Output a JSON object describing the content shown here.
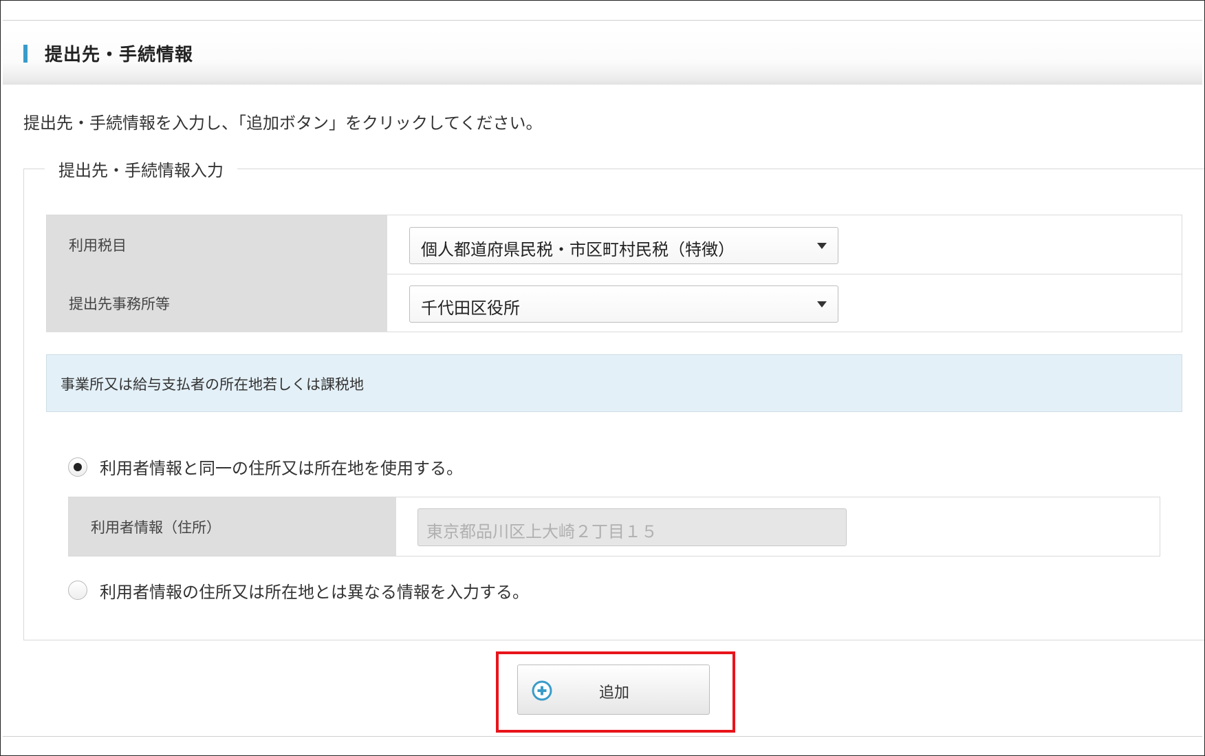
{
  "section": {
    "title": "提出先・手続情報",
    "instruction": "提出先・手続情報を入力し、「追加ボタン」をクリックしてください。"
  },
  "form": {
    "legend": "提出先・手続情報入力",
    "tax_item": {
      "label": "利用税目",
      "value": "個人都道府県民税・市区町村民税（特徴）"
    },
    "office": {
      "label": "提出先事務所等",
      "value": "千代田区役所"
    }
  },
  "location": {
    "heading": "事業所又は給与支払者の所在地若しくは課税地",
    "option_same": {
      "label": "利用者情報と同一の住所又は所在地を使用する。",
      "selected": true
    },
    "user_address": {
      "label": "利用者情報（住所）",
      "value": "東京都品川区上大崎２丁目１５"
    },
    "option_different": {
      "label": "利用者情報の住所又は所在地とは異なる情報を入力する。",
      "selected": false
    }
  },
  "actions": {
    "add_label": "追加"
  },
  "colors": {
    "accent_bar": "#3a9bc9",
    "highlight_border": "#e8141b",
    "info_band": "#e3f0f7",
    "label_cell": "#dedede"
  },
  "icons": {
    "add": "plus-circle-icon",
    "select_caret": "caret-down-icon"
  }
}
